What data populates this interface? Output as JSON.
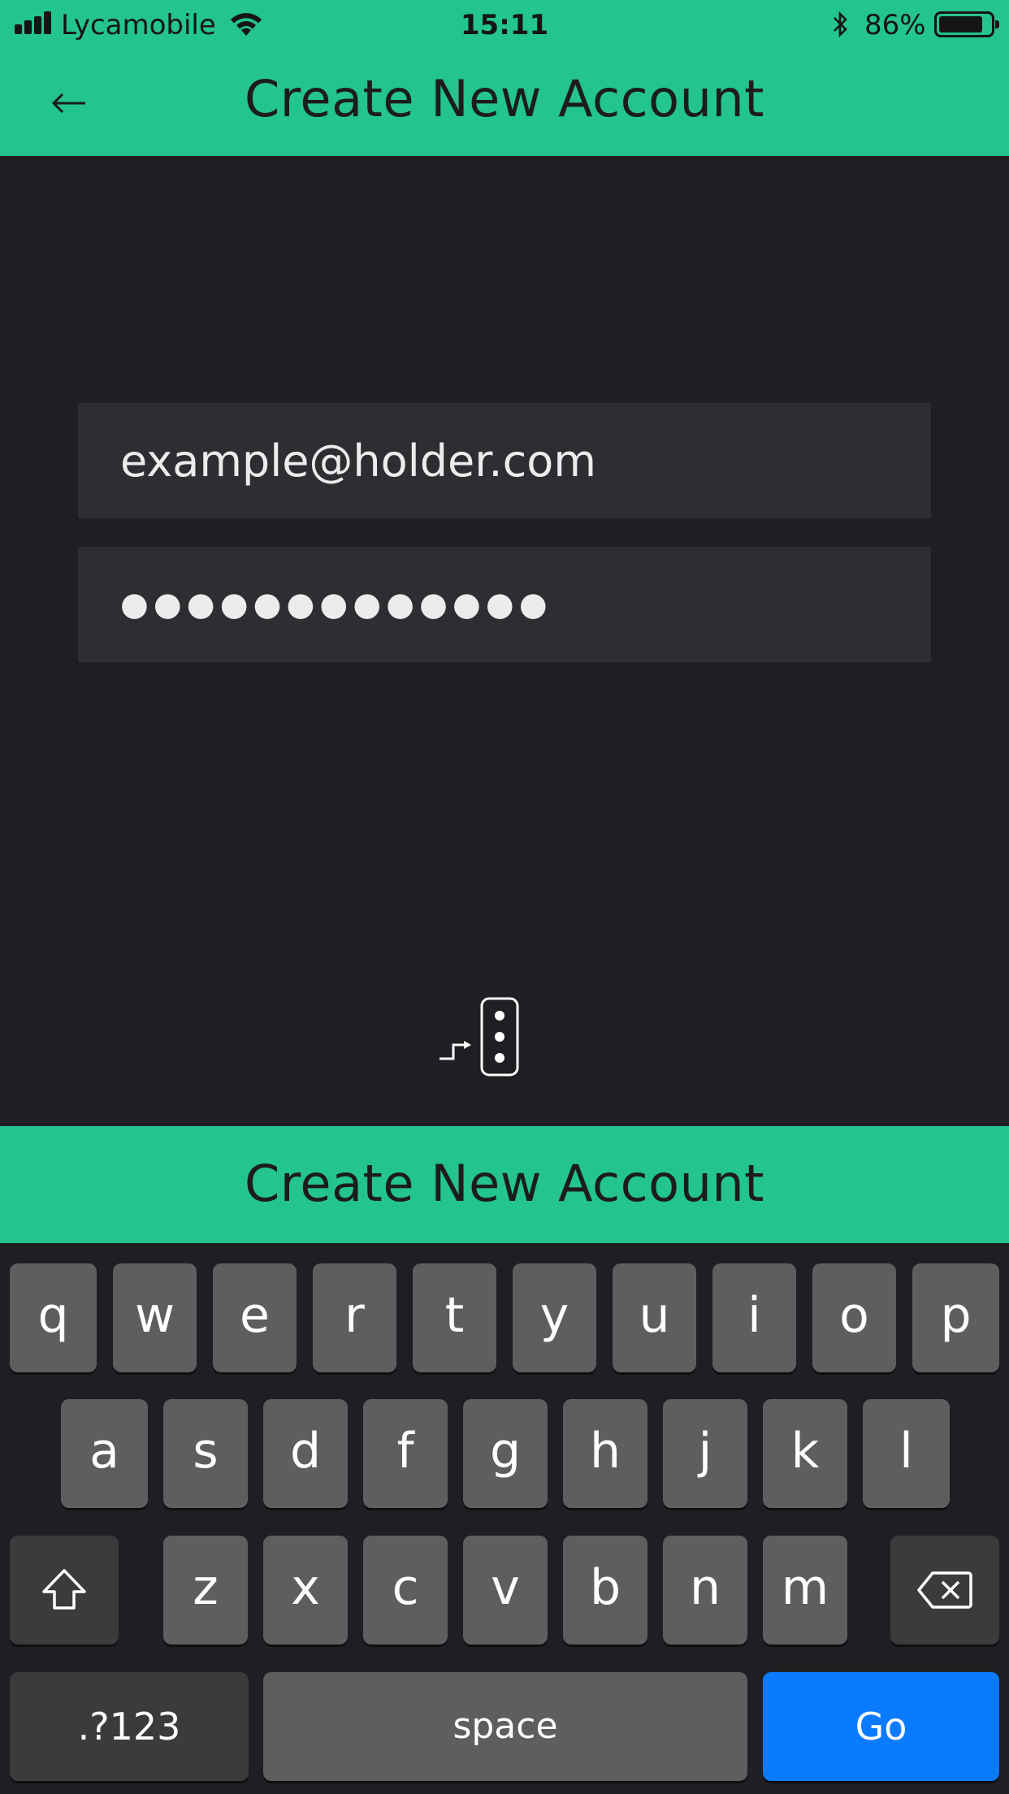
{
  "status_bar": {
    "carrier": "Lycamobile",
    "time": "15:11",
    "battery_percent": "86%",
    "battery_level": 0.86,
    "signal_bars": 4
  },
  "nav": {
    "title": "Create New Account",
    "back_icon": "arrow-left-icon"
  },
  "form": {
    "email_value": "example@holder.com",
    "password_value": "●●●●●●●●●●●●●"
  },
  "server_icon": "server-connect-icon",
  "create_button_label": "Create New Account",
  "keyboard": {
    "row1": [
      "q",
      "w",
      "e",
      "r",
      "t",
      "y",
      "u",
      "i",
      "o",
      "p"
    ],
    "row2": [
      "a",
      "s",
      "d",
      "f",
      "g",
      "h",
      "j",
      "k",
      "l"
    ],
    "row3": [
      "z",
      "x",
      "c",
      "v",
      "b",
      "n",
      "m"
    ],
    "numbers_label": ".?123",
    "space_label": "space",
    "go_label": "Go",
    "shift_icon": "shift-icon",
    "delete_icon": "backspace-icon",
    "go_color": "#0a7aff"
  },
  "colors": {
    "accent": "#23c48e",
    "background": "#1f1f23",
    "field_background": "#2d2d32"
  }
}
